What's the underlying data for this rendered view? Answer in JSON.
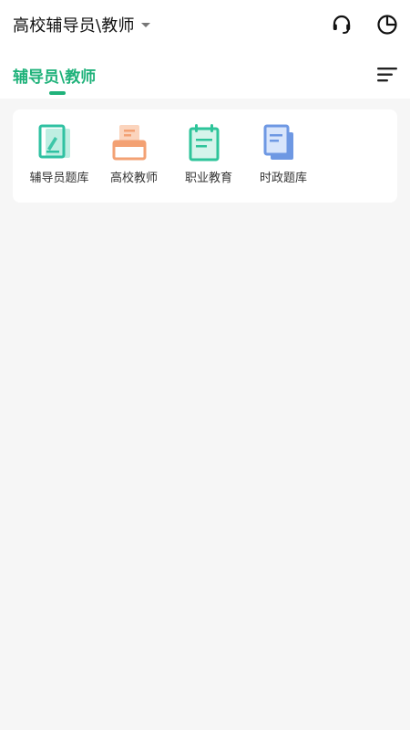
{
  "header": {
    "title": "高校辅导员\\教师",
    "support_icon": "headset-icon",
    "stats_icon": "pie-chart-icon",
    "dropdown_icon": "caret-down-icon"
  },
  "tabs": {
    "active_label": "辅导员\\教师",
    "menu_icon": "sort-menu-icon"
  },
  "colors": {
    "accent": "#1fb27a",
    "teal_icon": "#2fc1a2",
    "orange_icon": "#f3a173",
    "green_icon": "#2ec49a",
    "blue_icon": "#6e98e3"
  },
  "categories": [
    {
      "label": "辅导员题库",
      "icon": "question-bank-icon"
    },
    {
      "label": "高校教师",
      "icon": "printer-doc-icon"
    },
    {
      "label": "职业教育",
      "icon": "notepad-icon"
    },
    {
      "label": "时政题库",
      "icon": "documents-stack-icon"
    }
  ]
}
